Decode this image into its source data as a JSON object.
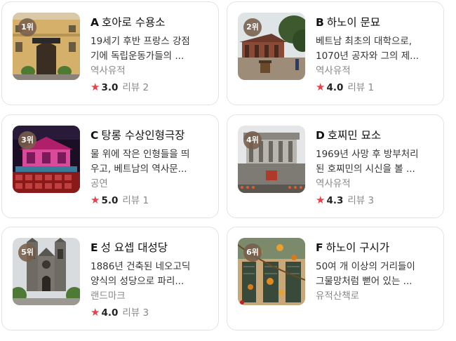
{
  "places": [
    {
      "rank": "1위",
      "letter": "A",
      "name": "호아로 수용소",
      "desc_line1": "19세기 후반 프랑스 강점",
      "desc_line2": "기에 독립운동가들의 ...",
      "category": "역사유적",
      "score": "3.0",
      "reviews": "리뷰 2",
      "star": "★"
    },
    {
      "rank": "2위",
      "letter": "B",
      "name": "하노이 문묘",
      "desc_line1": "베트남 최초의 대학으로,",
      "desc_line2": "1070년 공자와 그의 제...",
      "category": "역사유적",
      "score": "4.0",
      "reviews": "리뷰 1",
      "star": "★"
    },
    {
      "rank": "3위",
      "letter": "C",
      "name": "탕롱 수상인형극장",
      "desc_line1": "물 위에 작은 인형들을 띄",
      "desc_line2": "우고, 베트남의 역사문...",
      "category": "공연",
      "score": "5.0",
      "reviews": "리뷰 1",
      "star": "★"
    },
    {
      "rank": "4위",
      "letter": "D",
      "name": "호찌민 묘소",
      "desc_line1": "1969년 사망 후 방부처리",
      "desc_line2": "된 호찌민의 시신을 볼 ...",
      "category": "역사유적",
      "score": "4.3",
      "reviews": "리뷰 3",
      "star": "★"
    },
    {
      "rank": "5위",
      "letter": "E",
      "name": "성 요셉 대성당",
      "desc_line1": "1886년 건축된 네오고딕",
      "desc_line2": "양식의 성당으로 파리...",
      "category": "랜드마크",
      "score": "4.0",
      "reviews": "리뷰 3",
      "star": "★"
    },
    {
      "rank": "6위",
      "letter": "F",
      "name": "하노이 구시가",
      "desc_line1": "50여 개 이상의 거리들이",
      "desc_line2": "그물망처럼 뻗어 있는 ...",
      "category": "유적산책로",
      "score": "",
      "reviews": "",
      "star": ""
    }
  ],
  "colors": {
    "star": "#e8404a",
    "rank_badge": "#785f4b",
    "border": "#e3e3e3"
  }
}
